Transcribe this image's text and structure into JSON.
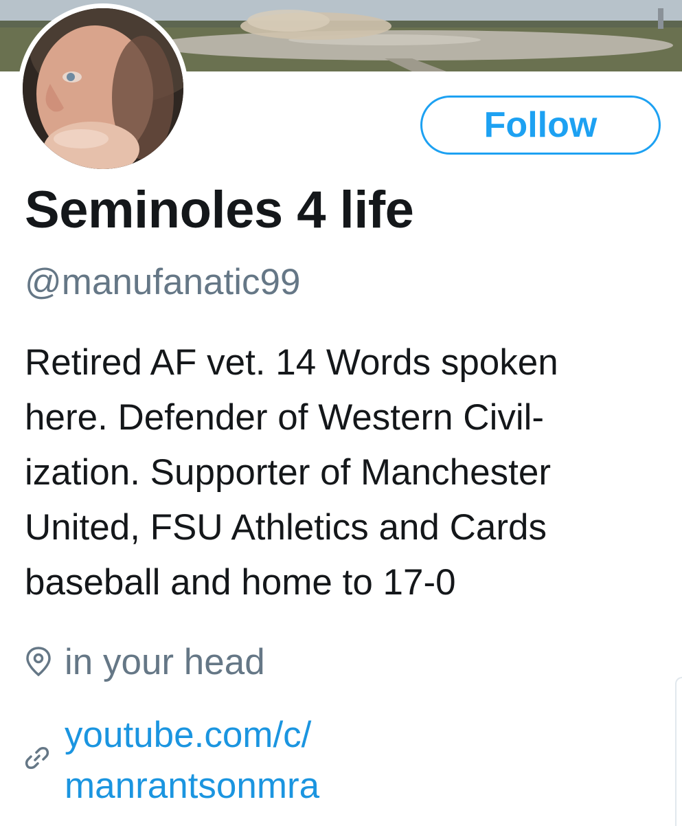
{
  "profile": {
    "display_name": "Seminoles 4 life",
    "handle": "@manufanatic99",
    "bio_lines": [
      "Retired AF vet. 14 Words spoken",
      "here. Defender of Western Civil-",
      "ization. Supporter of Manchester",
      "United, FSU Athletics and Cards",
      "baseball and home to 17-0"
    ],
    "location": "in your head",
    "url_lines": [
      "youtube.com/c/",
      "manrantsonmra"
    ]
  },
  "actions": {
    "follow_label": "Follow"
  },
  "icons": {
    "location": "map-pin-icon",
    "url": "link-icon"
  },
  "colors": {
    "accent": "#1da1f2",
    "link": "#1b95e0",
    "secondary_text": "#657786",
    "primary_text": "#14171a"
  }
}
